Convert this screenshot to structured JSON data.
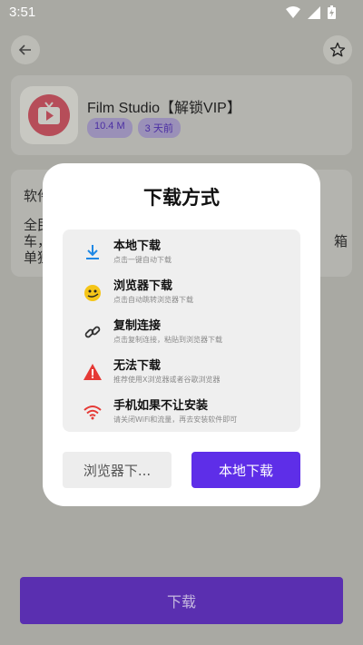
{
  "status_bar": {
    "time": "3:51",
    "icons": [
      "wifi-icon",
      "signal-icon",
      "battery-charging-icon"
    ]
  },
  "app": {
    "title": "Film Studio【解锁VIP】",
    "size": "10.4 M",
    "updated": "3 天前",
    "icon": "tv-play-icon"
  },
  "description": {
    "line1": "软件",
    "line2": "全民",
    "line3": "车，",
    "line4": "单独",
    "line2_tail": "箱"
  },
  "bottom_button": {
    "label": "下载"
  },
  "dialog": {
    "title": "下载方式",
    "options": [
      {
        "title": "本地下载",
        "desc": "点击一键自动下载",
        "icon": "download-icon",
        "color": "#1e88e5"
      },
      {
        "title": "浏览器下载",
        "desc": "点击自动跳转浏览器下载",
        "icon": "browser-bird-icon",
        "color": "#f5c518"
      },
      {
        "title": "复制连接",
        "desc": "点击复制连接，粘贴到浏览器下载",
        "icon": "link-icon",
        "color": "#333333"
      },
      {
        "title": "无法下载",
        "desc": "推荐使用X浏览器或者谷歌浏览器",
        "icon": "warning-icon",
        "color": "#e53935"
      },
      {
        "title": "手机如果不让安装",
        "desc": "请关闭WiFi和流量，再去安装软件即可",
        "icon": "wifi-icon",
        "color": "#e53935"
      }
    ],
    "browser_button": "浏览器下...",
    "local_button": "本地下载"
  },
  "colors": {
    "accent": "#5e2ee8",
    "overlay_bg": "#a9a9a3"
  }
}
